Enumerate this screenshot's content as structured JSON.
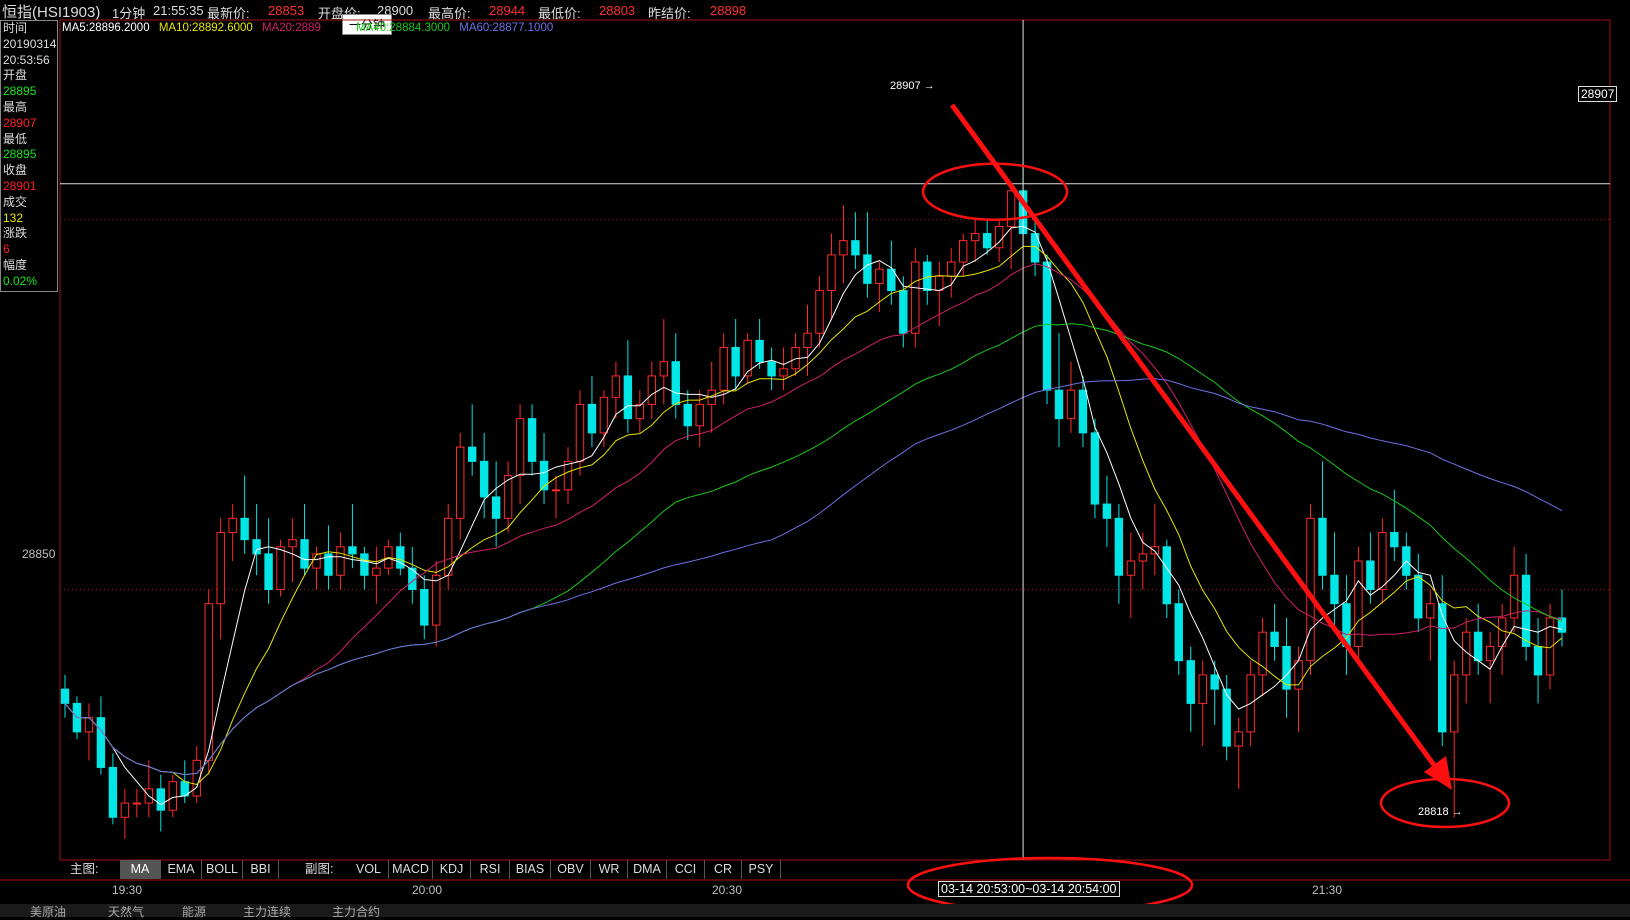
{
  "header": {
    "symbol": "恒指(HSI1903)",
    "period": "1分钟",
    "time": "21:55:35",
    "last_label": "最新价:",
    "last_value": "28853",
    "open_label": "开盘价:",
    "open_value": "28900",
    "high_label": "最高价:",
    "high_value": "28944",
    "low_label": "最低价:",
    "low_value": "28803",
    "prev_label": "昨结价:",
    "prev_value": "28898"
  },
  "tooltip": "一分钟",
  "info": {
    "time_label": "时间",
    "date": "20190314",
    "time": "20:53:56",
    "open_label": "开盘",
    "open": "28895",
    "high_label": "最高",
    "high": "28907",
    "low_label": "最低",
    "low": "28895",
    "close_label": "收盘",
    "close": "28901",
    "volume_label": "成交",
    "volume": "132",
    "change_label": "涨跌",
    "change": "6",
    "amp_label": "幅度",
    "amp": "0.02%"
  },
  "ma_legend": {
    "ma5": "MA5:28896.2000",
    "ma10": "MA10:28892.6000",
    "ma20": "MA20:2889",
    "ma40": "MA40:28884.3000",
    "ma60": "MA60:28877.1000"
  },
  "colors": {
    "up": "#ff2a2a",
    "down": "#00e5e5",
    "ma5": "#ffffff",
    "ma10": "#e6e600",
    "ma20": "#d0206a",
    "ma40": "#18c818",
    "ma60": "#7070e6",
    "annotation": "#ff1010"
  },
  "main_indicator_label": "主图:",
  "main_tabs": [
    "MA",
    "EMA",
    "BOLL",
    "BBI"
  ],
  "sub_indicator_label": "副图:",
  "sub_tabs": [
    "VOL",
    "MACD",
    "KDJ",
    "RSI",
    "BIAS",
    "OBV",
    "WR",
    "DMA",
    "CCI",
    "CR",
    "PSY"
  ],
  "crosshair_range": "03-14  20:53:00~03-14 20:54:00",
  "crosshair_price": "28907",
  "annotations": {
    "peak": "28907",
    "trough": "28818"
  },
  "bottom_tabs": [
    "美原油",
    "天然气",
    "能源",
    "主力连续",
    "主力合约"
  ],
  "chart_data": {
    "type": "candlestick",
    "title": "恒指(HSI1903) 1分钟",
    "x_tick_labels": [
      "19:30",
      "20:00",
      "20:30",
      "21:30"
    ],
    "y_tick_labels": [
      "28850"
    ],
    "y_range": [
      28812,
      28930
    ],
    "grid": false,
    "candles": [
      {
        "o": 28836,
        "h": 28838,
        "l": 28832,
        "c": 28834
      },
      {
        "o": 28834,
        "h": 28835,
        "l": 28829,
        "c": 28830
      },
      {
        "o": 28830,
        "h": 28834,
        "l": 28826,
        "c": 28832
      },
      {
        "o": 28832,
        "h": 28835,
        "l": 28824,
        "c": 28825
      },
      {
        "o": 28825,
        "h": 28827,
        "l": 28817,
        "c": 28818
      },
      {
        "o": 28818,
        "h": 28822,
        "l": 28815,
        "c": 28820
      },
      {
        "o": 28820,
        "h": 28822,
        "l": 28818,
        "c": 28820
      },
      {
        "o": 28820,
        "h": 28826,
        "l": 28818,
        "c": 28822
      },
      {
        "o": 28822,
        "h": 28824,
        "l": 28816,
        "c": 28819
      },
      {
        "o": 28819,
        "h": 28824,
        "l": 28818,
        "c": 28823
      },
      {
        "o": 28823,
        "h": 28826,
        "l": 28820,
        "c": 28821
      },
      {
        "o": 28821,
        "h": 28828,
        "l": 28820,
        "c": 28826
      },
      {
        "o": 28826,
        "h": 28850,
        "l": 28824,
        "c": 28848
      },
      {
        "o": 28848,
        "h": 28860,
        "l": 28843,
        "c": 28858
      },
      {
        "o": 28858,
        "h": 28862,
        "l": 28854,
        "c": 28860
      },
      {
        "o": 28860,
        "h": 28866,
        "l": 28855,
        "c": 28857
      },
      {
        "o": 28857,
        "h": 28862,
        "l": 28852,
        "c": 28855
      },
      {
        "o": 28855,
        "h": 28860,
        "l": 28848,
        "c": 28850
      },
      {
        "o": 28850,
        "h": 28857,
        "l": 28849,
        "c": 28856
      },
      {
        "o": 28856,
        "h": 28860,
        "l": 28851,
        "c": 28857
      },
      {
        "o": 28857,
        "h": 28862,
        "l": 28852,
        "c": 28853
      },
      {
        "o": 28853,
        "h": 28856,
        "l": 28850,
        "c": 28855
      },
      {
        "o": 28855,
        "h": 28859,
        "l": 28850,
        "c": 28852
      },
      {
        "o": 28852,
        "h": 28858,
        "l": 28850,
        "c": 28856
      },
      {
        "o": 28856,
        "h": 28862,
        "l": 28853,
        "c": 28855
      },
      {
        "o": 28855,
        "h": 28856,
        "l": 28850,
        "c": 28852
      },
      {
        "o": 28852,
        "h": 28856,
        "l": 28848,
        "c": 28853
      },
      {
        "o": 28853,
        "h": 28857,
        "l": 28852,
        "c": 28856
      },
      {
        "o": 28856,
        "h": 28858,
        "l": 28852,
        "c": 28853
      },
      {
        "o": 28853,
        "h": 28856,
        "l": 28848,
        "c": 28850
      },
      {
        "o": 28850,
        "h": 28852,
        "l": 28843,
        "c": 28845
      },
      {
        "o": 28845,
        "h": 28854,
        "l": 28842,
        "c": 28852
      },
      {
        "o": 28852,
        "h": 28862,
        "l": 28850,
        "c": 28860
      },
      {
        "o": 28860,
        "h": 28872,
        "l": 28857,
        "c": 28870
      },
      {
        "o": 28870,
        "h": 28876,
        "l": 28866,
        "c": 28868
      },
      {
        "o": 28868,
        "h": 28872,
        "l": 28860,
        "c": 28863
      },
      {
        "o": 28863,
        "h": 28868,
        "l": 28856,
        "c": 28860
      },
      {
        "o": 28860,
        "h": 28868,
        "l": 28858,
        "c": 28866
      },
      {
        "o": 28866,
        "h": 28876,
        "l": 28862,
        "c": 28874
      },
      {
        "o": 28874,
        "h": 28876,
        "l": 28866,
        "c": 28868
      },
      {
        "o": 28868,
        "h": 28872,
        "l": 28862,
        "c": 28864
      },
      {
        "o": 28864,
        "h": 28866,
        "l": 28860,
        "c": 28864
      },
      {
        "o": 28864,
        "h": 28870,
        "l": 28862,
        "c": 28868
      },
      {
        "o": 28868,
        "h": 28878,
        "l": 28866,
        "c": 28876
      },
      {
        "o": 28876,
        "h": 28880,
        "l": 28870,
        "c": 28872
      },
      {
        "o": 28872,
        "h": 28878,
        "l": 28870,
        "c": 28877
      },
      {
        "o": 28877,
        "h": 28882,
        "l": 28874,
        "c": 28880
      },
      {
        "o": 28880,
        "h": 28885,
        "l": 28872,
        "c": 28874
      },
      {
        "o": 28874,
        "h": 28878,
        "l": 28872,
        "c": 28876
      },
      {
        "o": 28876,
        "h": 28882,
        "l": 28874,
        "c": 28880
      },
      {
        "o": 28880,
        "h": 28888,
        "l": 28876,
        "c": 28882
      },
      {
        "o": 28882,
        "h": 28886,
        "l": 28874,
        "c": 28876
      },
      {
        "o": 28876,
        "h": 28878,
        "l": 28871,
        "c": 28873
      },
      {
        "o": 28873,
        "h": 28878,
        "l": 28870,
        "c": 28876
      },
      {
        "o": 28876,
        "h": 28882,
        "l": 28872,
        "c": 28878
      },
      {
        "o": 28878,
        "h": 28886,
        "l": 28876,
        "c": 28884
      },
      {
        "o": 28884,
        "h": 28888,
        "l": 28878,
        "c": 28880
      },
      {
        "o": 28880,
        "h": 28886,
        "l": 28879,
        "c": 28885
      },
      {
        "o": 28885,
        "h": 28888,
        "l": 28881,
        "c": 28882
      },
      {
        "o": 28882,
        "h": 28884,
        "l": 28878,
        "c": 28880
      },
      {
        "o": 28880,
        "h": 28884,
        "l": 28878,
        "c": 28881
      },
      {
        "o": 28881,
        "h": 28886,
        "l": 28880,
        "c": 28884
      },
      {
        "o": 28884,
        "h": 28890,
        "l": 28880,
        "c": 28886
      },
      {
        "o": 28886,
        "h": 28894,
        "l": 28884,
        "c": 28892
      },
      {
        "o": 28892,
        "h": 28900,
        "l": 28888,
        "c": 28897
      },
      {
        "o": 28897,
        "h": 28904,
        "l": 28893,
        "c": 28899
      },
      {
        "o": 28899,
        "h": 28903,
        "l": 28895,
        "c": 28897
      },
      {
        "o": 28897,
        "h": 28903,
        "l": 28891,
        "c": 28893
      },
      {
        "o": 28893,
        "h": 28896,
        "l": 28889,
        "c": 28895
      },
      {
        "o": 28895,
        "h": 28899,
        "l": 28890,
        "c": 28892
      },
      {
        "o": 28892,
        "h": 28894,
        "l": 28884,
        "c": 28886
      },
      {
        "o": 28886,
        "h": 28898,
        "l": 28884,
        "c": 28896
      },
      {
        "o": 28896,
        "h": 28897,
        "l": 28890,
        "c": 28892
      },
      {
        "o": 28892,
        "h": 28896,
        "l": 28887,
        "c": 28894
      },
      {
        "o": 28894,
        "h": 28898,
        "l": 28891,
        "c": 28896
      },
      {
        "o": 28896,
        "h": 28900,
        "l": 28894,
        "c": 28899
      },
      {
        "o": 28899,
        "h": 28902,
        "l": 28896,
        "c": 28900
      },
      {
        "o": 28900,
        "h": 28902,
        "l": 28897,
        "c": 28898
      },
      {
        "o": 28898,
        "h": 28902,
        "l": 28896,
        "c": 28901
      },
      {
        "o": 28901,
        "h": 28907,
        "l": 28895,
        "c": 28906
      },
      {
        "o": 28906,
        "h": 28910,
        "l": 28898,
        "c": 28900
      },
      {
        "o": 28900,
        "h": 28902,
        "l": 28894,
        "c": 28896
      },
      {
        "o": 28896,
        "h": 28897,
        "l": 28876,
        "c": 28878
      },
      {
        "o": 28878,
        "h": 28886,
        "l": 28870,
        "c": 28874
      },
      {
        "o": 28874,
        "h": 28882,
        "l": 28872,
        "c": 28878
      },
      {
        "o": 28878,
        "h": 28880,
        "l": 28870,
        "c": 28872
      },
      {
        "o": 28872,
        "h": 28874,
        "l": 28860,
        "c": 28862
      },
      {
        "o": 28862,
        "h": 28866,
        "l": 28856,
        "c": 28860
      },
      {
        "o": 28860,
        "h": 28862,
        "l": 28848,
        "c": 28852
      },
      {
        "o": 28852,
        "h": 28858,
        "l": 28846,
        "c": 28854
      },
      {
        "o": 28854,
        "h": 28858,
        "l": 28850,
        "c": 28855
      },
      {
        "o": 28855,
        "h": 28862,
        "l": 28852,
        "c": 28856
      },
      {
        "o": 28856,
        "h": 28857,
        "l": 28846,
        "c": 28848
      },
      {
        "o": 28848,
        "h": 28850,
        "l": 28838,
        "c": 28840
      },
      {
        "o": 28840,
        "h": 28842,
        "l": 28830,
        "c": 28834
      },
      {
        "o": 28834,
        "h": 28840,
        "l": 28828,
        "c": 28838
      },
      {
        "o": 28838,
        "h": 28840,
        "l": 28831,
        "c": 28836
      },
      {
        "o": 28836,
        "h": 28838,
        "l": 28826,
        "c": 28828
      },
      {
        "o": 28828,
        "h": 28832,
        "l": 28822,
        "c": 28830
      },
      {
        "o": 28830,
        "h": 28840,
        "l": 28828,
        "c": 28838
      },
      {
        "o": 28838,
        "h": 28846,
        "l": 28835,
        "c": 28844
      },
      {
        "o": 28844,
        "h": 28848,
        "l": 28840,
        "c": 28842
      },
      {
        "o": 28842,
        "h": 28846,
        "l": 28832,
        "c": 28836
      },
      {
        "o": 28836,
        "h": 28842,
        "l": 28830,
        "c": 28840
      },
      {
        "o": 28840,
        "h": 28862,
        "l": 28838,
        "c": 28860
      },
      {
        "o": 28860,
        "h": 28868,
        "l": 28850,
        "c": 28852
      },
      {
        "o": 28852,
        "h": 28858,
        "l": 28844,
        "c": 28848
      },
      {
        "o": 28848,
        "h": 28852,
        "l": 28838,
        "c": 28842
      },
      {
        "o": 28842,
        "h": 28856,
        "l": 28840,
        "c": 28854
      },
      {
        "o": 28854,
        "h": 28858,
        "l": 28848,
        "c": 28850
      },
      {
        "o": 28850,
        "h": 28860,
        "l": 28848,
        "c": 28858
      },
      {
        "o": 28858,
        "h": 28864,
        "l": 28854,
        "c": 28856
      },
      {
        "o": 28856,
        "h": 28858,
        "l": 28850,
        "c": 28852
      },
      {
        "o": 28852,
        "h": 28855,
        "l": 28844,
        "c": 28846
      },
      {
        "o": 28846,
        "h": 28850,
        "l": 28840,
        "c": 28848
      },
      {
        "o": 28848,
        "h": 28852,
        "l": 28828,
        "c": 28830
      },
      {
        "o": 28830,
        "h": 28840,
        "l": 28818,
        "c": 28838
      },
      {
        "o": 28838,
        "h": 28846,
        "l": 28834,
        "c": 28844
      },
      {
        "o": 28844,
        "h": 28848,
        "l": 28838,
        "c": 28840
      },
      {
        "o": 28840,
        "h": 28844,
        "l": 28834,
        "c": 28842
      },
      {
        "o": 28842,
        "h": 28848,
        "l": 28838,
        "c": 28846
      },
      {
        "o": 28846,
        "h": 28856,
        "l": 28844,
        "c": 28852
      },
      {
        "o": 28852,
        "h": 28855,
        "l": 28840,
        "c": 28842
      },
      {
        "o": 28842,
        "h": 28846,
        "l": 28834,
        "c": 28838
      },
      {
        "o": 28838,
        "h": 28848,
        "l": 28836,
        "c": 28846
      },
      {
        "o": 28846,
        "h": 28850,
        "l": 28842,
        "c": 28844
      }
    ],
    "series": [
      {
        "name": "MA5",
        "values": []
      },
      {
        "name": "MA10",
        "values": []
      },
      {
        "name": "MA20",
        "values": []
      },
      {
        "name": "MA40",
        "values": []
      },
      {
        "name": "MA60",
        "values": []
      }
    ]
  }
}
